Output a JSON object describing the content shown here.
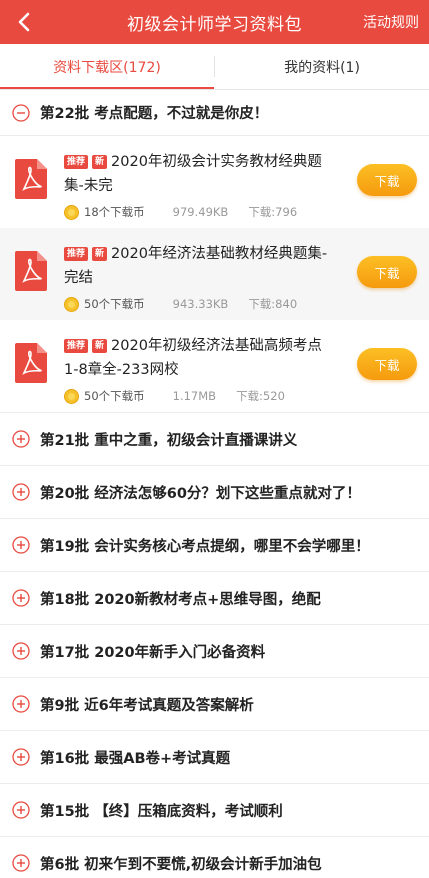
{
  "header": {
    "title": "初级会计师学习资料包",
    "right_label": "活动规则"
  },
  "tabs": [
    {
      "label": "资料下载区(172)"
    },
    {
      "label": "我的资料(1)"
    }
  ],
  "open_batch": {
    "title": "第22批 考点配题，不过就是你皮！",
    "files": [
      {
        "badge_recommend": "推荐",
        "badge_new": "新",
        "title": "2020年初级会计实务教材经典题集-未完",
        "cost": "18个下载币",
        "size": "979.49KB",
        "downloads": "下载:796",
        "button": "下载"
      },
      {
        "badge_recommend": "推荐",
        "badge_new": "新",
        "title": "2020年经济法基础教材经典题集-完结",
        "cost": "50个下载币",
        "size": "943.33KB",
        "downloads": "下载:840",
        "button": "下载"
      },
      {
        "badge_recommend": "推荐",
        "badge_new": "新",
        "title": "2020年初级经济法基础高频考点1-8章全-233网校",
        "cost": "50个下载币",
        "size": "1.17MB",
        "downloads": "下载:520",
        "button": "下载"
      }
    ]
  },
  "batches": [
    {
      "title": "第21批 重中之重，初级会计直播课讲义"
    },
    {
      "title": "第20批 经济法怎够60分？划下这些重点就对了！"
    },
    {
      "title": "第19批 会计实务核心考点提纲，哪里不会学哪里！"
    },
    {
      "title": "第18批 2020新教材考点+思维导图，绝配"
    },
    {
      "title": "第17批 2020年新手入门必备资料"
    },
    {
      "title": "第9批 近6年考试真题及答案解析"
    },
    {
      "title": "第16批 最强AB卷+考试真题"
    },
    {
      "title": "第15批 【终】压箱底资料，考试顺利"
    },
    {
      "title": "第6批 初来乍到不要慌,初级会计新手加油包"
    }
  ],
  "colors": {
    "accent": "#e84a3f",
    "button": "#f7a51a"
  }
}
